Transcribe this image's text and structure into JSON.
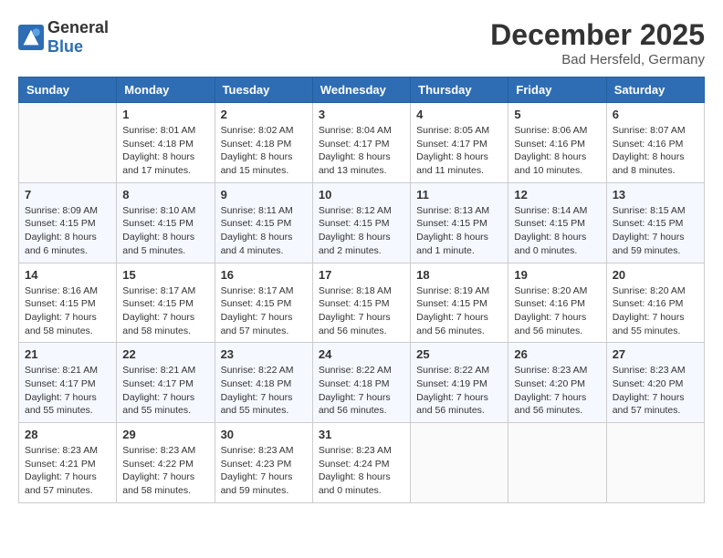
{
  "header": {
    "logo_general": "General",
    "logo_blue": "Blue",
    "month": "December 2025",
    "location": "Bad Hersfeld, Germany"
  },
  "days_of_week": [
    "Sunday",
    "Monday",
    "Tuesday",
    "Wednesday",
    "Thursday",
    "Friday",
    "Saturday"
  ],
  "weeks": [
    [
      {
        "day": "",
        "info": ""
      },
      {
        "day": "1",
        "info": "Sunrise: 8:01 AM\nSunset: 4:18 PM\nDaylight: 8 hours\nand 17 minutes."
      },
      {
        "day": "2",
        "info": "Sunrise: 8:02 AM\nSunset: 4:18 PM\nDaylight: 8 hours\nand 15 minutes."
      },
      {
        "day": "3",
        "info": "Sunrise: 8:04 AM\nSunset: 4:17 PM\nDaylight: 8 hours\nand 13 minutes."
      },
      {
        "day": "4",
        "info": "Sunrise: 8:05 AM\nSunset: 4:17 PM\nDaylight: 8 hours\nand 11 minutes."
      },
      {
        "day": "5",
        "info": "Sunrise: 8:06 AM\nSunset: 4:16 PM\nDaylight: 8 hours\nand 10 minutes."
      },
      {
        "day": "6",
        "info": "Sunrise: 8:07 AM\nSunset: 4:16 PM\nDaylight: 8 hours\nand 8 minutes."
      }
    ],
    [
      {
        "day": "7",
        "info": "Sunrise: 8:09 AM\nSunset: 4:15 PM\nDaylight: 8 hours\nand 6 minutes."
      },
      {
        "day": "8",
        "info": "Sunrise: 8:10 AM\nSunset: 4:15 PM\nDaylight: 8 hours\nand 5 minutes."
      },
      {
        "day": "9",
        "info": "Sunrise: 8:11 AM\nSunset: 4:15 PM\nDaylight: 8 hours\nand 4 minutes."
      },
      {
        "day": "10",
        "info": "Sunrise: 8:12 AM\nSunset: 4:15 PM\nDaylight: 8 hours\nand 2 minutes."
      },
      {
        "day": "11",
        "info": "Sunrise: 8:13 AM\nSunset: 4:15 PM\nDaylight: 8 hours\nand 1 minute."
      },
      {
        "day": "12",
        "info": "Sunrise: 8:14 AM\nSunset: 4:15 PM\nDaylight: 8 hours\nand 0 minutes."
      },
      {
        "day": "13",
        "info": "Sunrise: 8:15 AM\nSunset: 4:15 PM\nDaylight: 7 hours\nand 59 minutes."
      }
    ],
    [
      {
        "day": "14",
        "info": "Sunrise: 8:16 AM\nSunset: 4:15 PM\nDaylight: 7 hours\nand 58 minutes."
      },
      {
        "day": "15",
        "info": "Sunrise: 8:17 AM\nSunset: 4:15 PM\nDaylight: 7 hours\nand 58 minutes."
      },
      {
        "day": "16",
        "info": "Sunrise: 8:17 AM\nSunset: 4:15 PM\nDaylight: 7 hours\nand 57 minutes."
      },
      {
        "day": "17",
        "info": "Sunrise: 8:18 AM\nSunset: 4:15 PM\nDaylight: 7 hours\nand 56 minutes."
      },
      {
        "day": "18",
        "info": "Sunrise: 8:19 AM\nSunset: 4:15 PM\nDaylight: 7 hours\nand 56 minutes."
      },
      {
        "day": "19",
        "info": "Sunrise: 8:20 AM\nSunset: 4:16 PM\nDaylight: 7 hours\nand 56 minutes."
      },
      {
        "day": "20",
        "info": "Sunrise: 8:20 AM\nSunset: 4:16 PM\nDaylight: 7 hours\nand 55 minutes."
      }
    ],
    [
      {
        "day": "21",
        "info": "Sunrise: 8:21 AM\nSunset: 4:17 PM\nDaylight: 7 hours\nand 55 minutes."
      },
      {
        "day": "22",
        "info": "Sunrise: 8:21 AM\nSunset: 4:17 PM\nDaylight: 7 hours\nand 55 minutes."
      },
      {
        "day": "23",
        "info": "Sunrise: 8:22 AM\nSunset: 4:18 PM\nDaylight: 7 hours\nand 55 minutes."
      },
      {
        "day": "24",
        "info": "Sunrise: 8:22 AM\nSunset: 4:18 PM\nDaylight: 7 hours\nand 56 minutes."
      },
      {
        "day": "25",
        "info": "Sunrise: 8:22 AM\nSunset: 4:19 PM\nDaylight: 7 hours\nand 56 minutes."
      },
      {
        "day": "26",
        "info": "Sunrise: 8:23 AM\nSunset: 4:20 PM\nDaylight: 7 hours\nand 56 minutes."
      },
      {
        "day": "27",
        "info": "Sunrise: 8:23 AM\nSunset: 4:20 PM\nDaylight: 7 hours\nand 57 minutes."
      }
    ],
    [
      {
        "day": "28",
        "info": "Sunrise: 8:23 AM\nSunset: 4:21 PM\nDaylight: 7 hours\nand 57 minutes."
      },
      {
        "day": "29",
        "info": "Sunrise: 8:23 AM\nSunset: 4:22 PM\nDaylight: 7 hours\nand 58 minutes."
      },
      {
        "day": "30",
        "info": "Sunrise: 8:23 AM\nSunset: 4:23 PM\nDaylight: 7 hours\nand 59 minutes."
      },
      {
        "day": "31",
        "info": "Sunrise: 8:23 AM\nSunset: 4:24 PM\nDaylight: 8 hours\nand 0 minutes."
      },
      {
        "day": "",
        "info": ""
      },
      {
        "day": "",
        "info": ""
      },
      {
        "day": "",
        "info": ""
      }
    ]
  ]
}
